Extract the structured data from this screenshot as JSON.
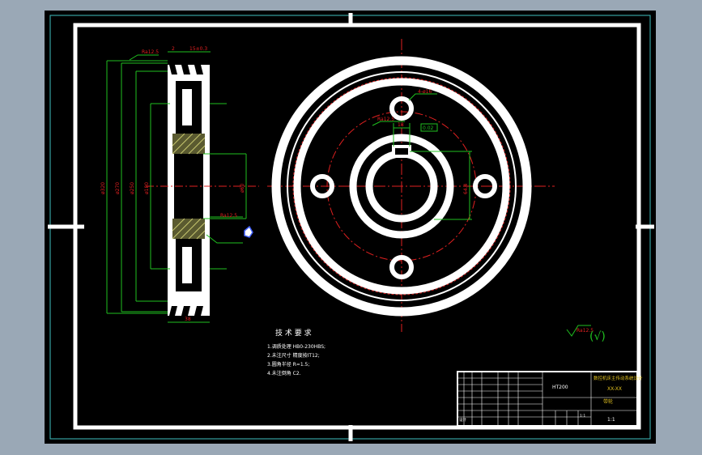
{
  "drawing": {
    "tech_requirements": {
      "title": "技 术 要 求",
      "items": [
        "1.调质处理 HB0-230HBS;",
        "2.未注尺寸 精度按IT12;",
        "3.圆角半径 R=1.5;",
        "4.未注倒角 C2."
      ]
    },
    "roughness_note": "(√)",
    "roughness_value": "Ra12.5",
    "title_block": {
      "part_name": "带轮",
      "material": "HT200",
      "school": "数控机床主传动系统设计",
      "scale": "1:1",
      "drawing_no": "XX-XX",
      "designer": "设计",
      "right_bottom": "1:1"
    },
    "dimensions": {
      "d1": "ø320",
      "d2": "ø270",
      "d3": "ø250",
      "d4": "ø180",
      "d5": "ø60",
      "top_width": "2",
      "top_spec": "15±0.3",
      "bottom_width": "38",
      "hole_dia": "4-ø16",
      "key_width": "18",
      "key_depth": "64.4",
      "pcd": "ø160",
      "tol1": "0.02",
      "tol2": "A"
    }
  }
}
